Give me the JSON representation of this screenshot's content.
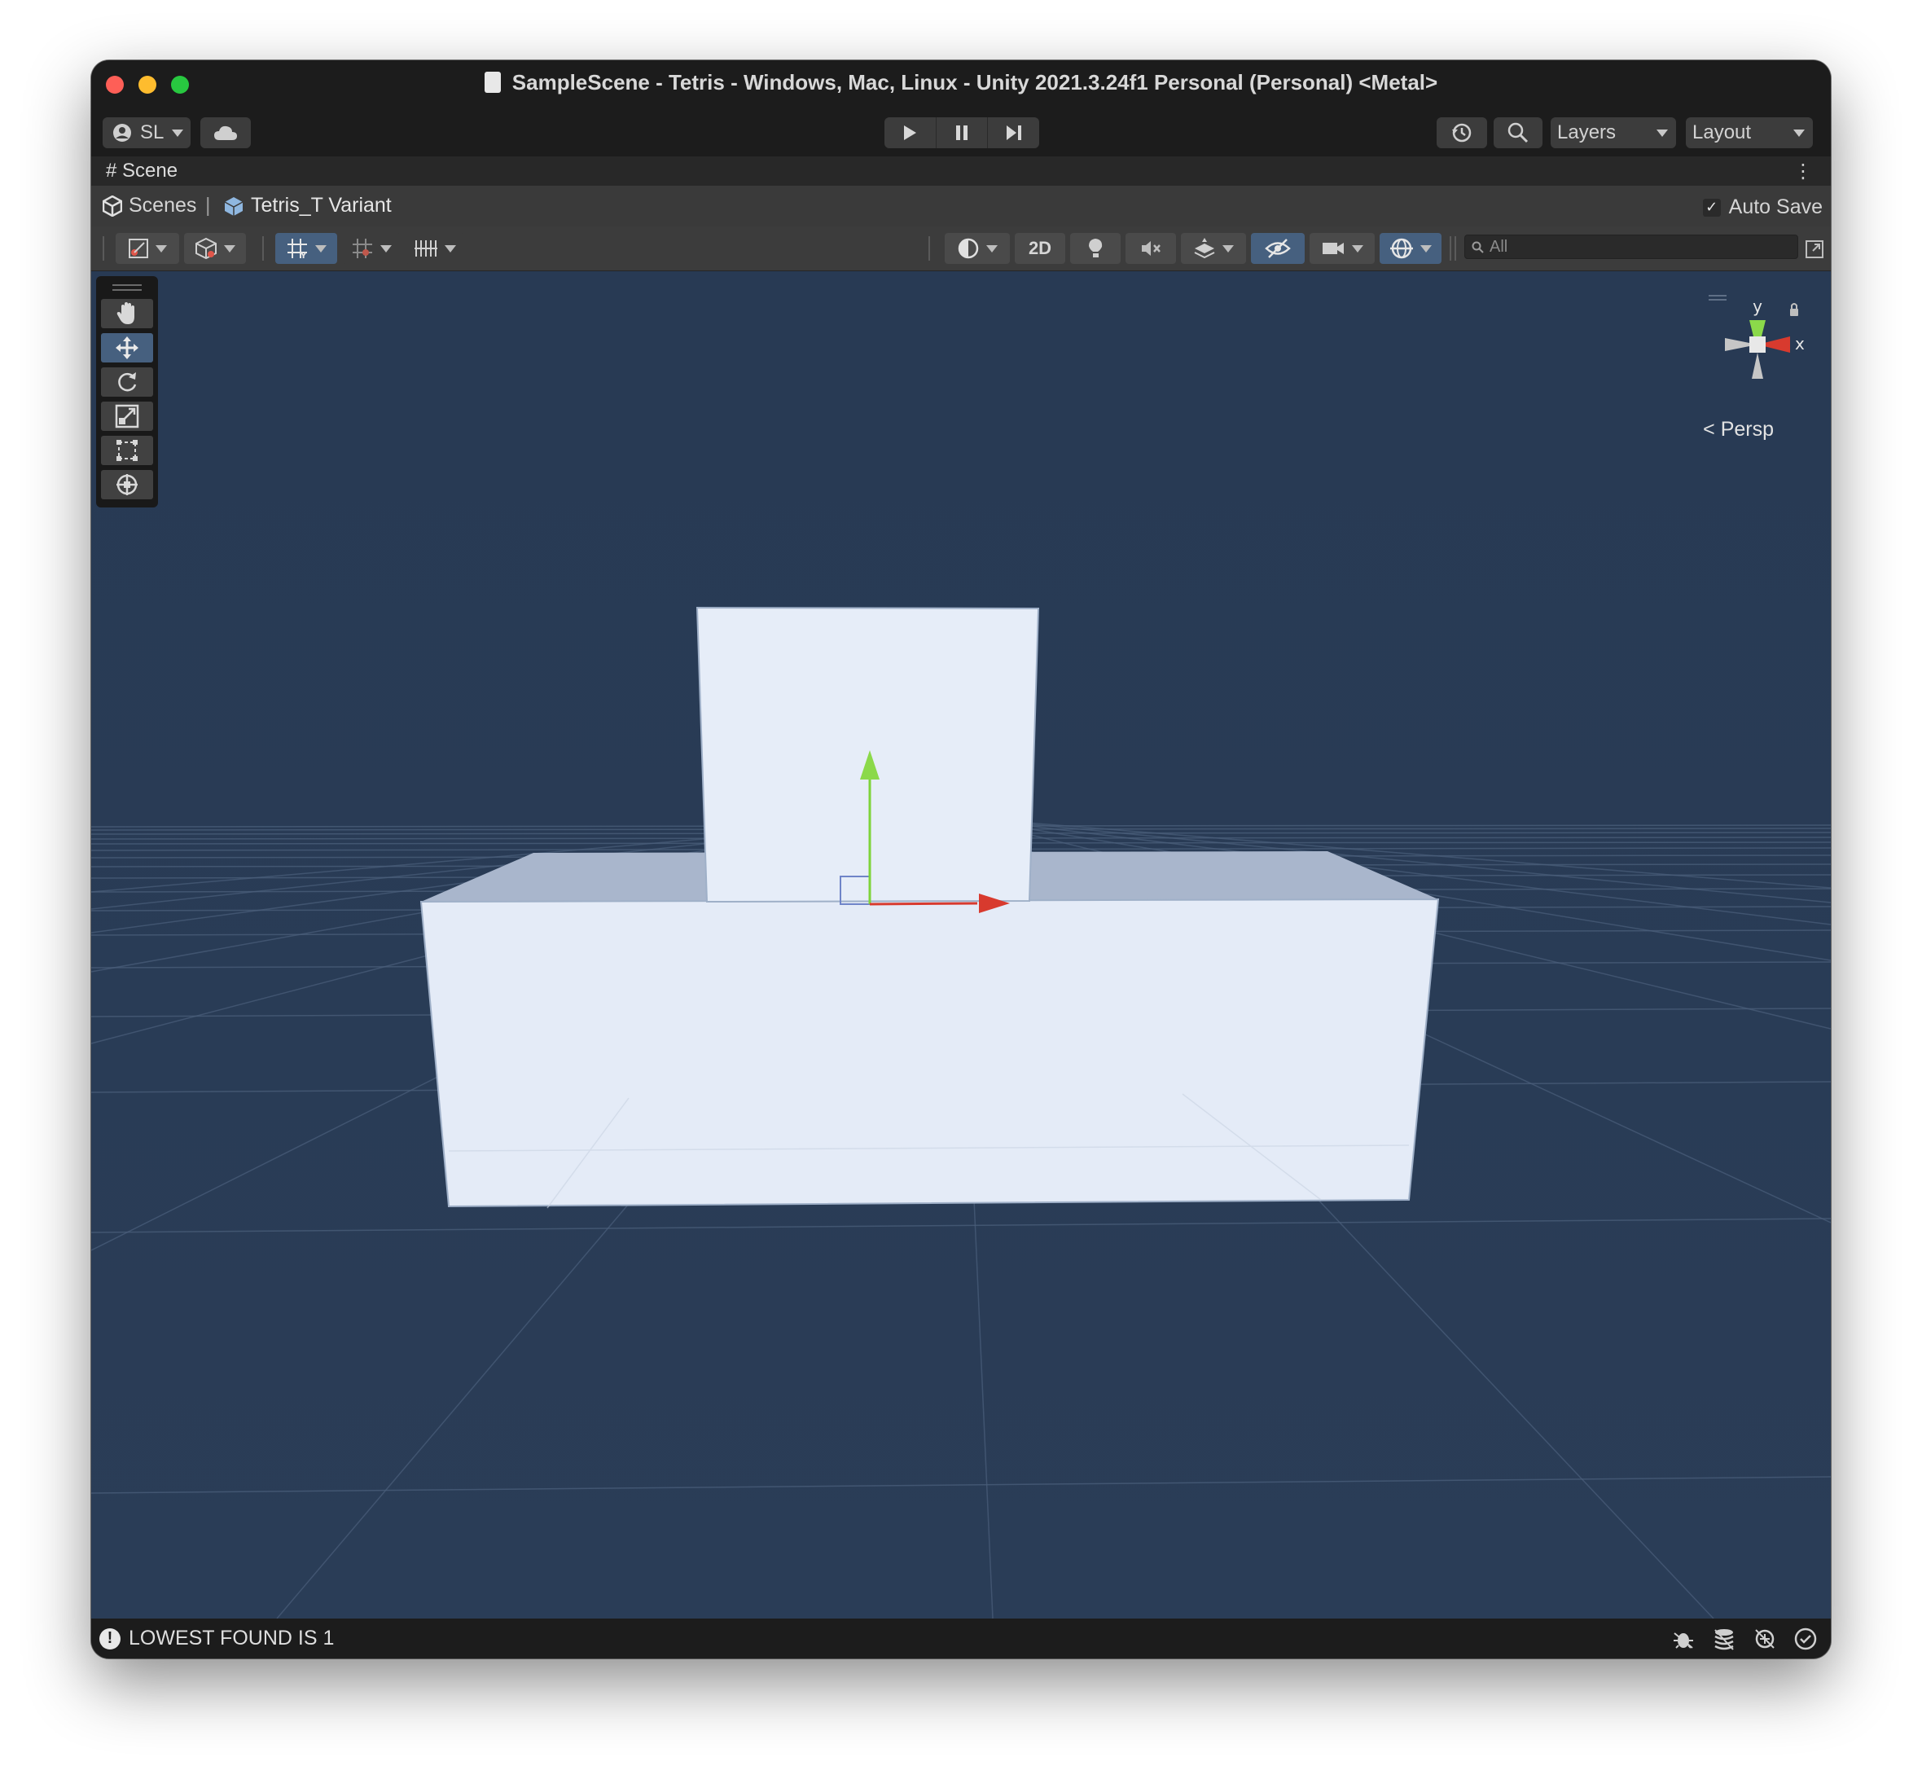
{
  "window": {
    "title": "SampleScene - Tetris - Windows, Mac, Linux - Unity 2021.3.24f1 Personal (Personal) <Metal>"
  },
  "toolbar": {
    "account_label": "SL",
    "layers_label": "Layers",
    "layout_label": "Layout"
  },
  "scene_tab": {
    "label": "Scene"
  },
  "breadcrumb": {
    "root": "Scenes",
    "current": "Tetris_T Variant",
    "auto_save_label": "Auto Save",
    "auto_save_checked": true
  },
  "scene_toolbar": {
    "mode_2d_label": "2D",
    "search_placeholder": "All"
  },
  "viewport": {
    "gizmo": {
      "y_label": "y",
      "x_label": "x"
    },
    "projection_label": "Persp"
  },
  "status": {
    "message": "LOWEST FOUND IS 1"
  },
  "colors": {
    "viewport_bg": "#283a54",
    "cube_face": "#e4ebf7",
    "cube_top": "#a9b6cc",
    "axis_x": "#d83a2e",
    "axis_y": "#7ed43a",
    "accent_active": "#46607f"
  }
}
